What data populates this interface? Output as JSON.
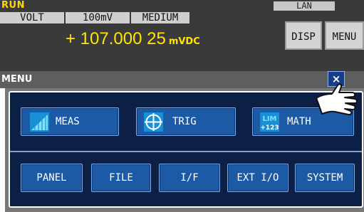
{
  "status": {
    "mode": "RUN",
    "interface": "LAN",
    "function": "VOLT",
    "range": "100mV",
    "speed": "MEDIUM",
    "reading": "+ 107.000 25",
    "unit": "mVDC"
  },
  "side_buttons": {
    "disp": "DISP",
    "menu": "MENU"
  },
  "menu": {
    "title": "MENU",
    "close": "×",
    "row1": [
      {
        "label": "MEAS",
        "icon": "bar-ramp-icon"
      },
      {
        "label": "TRIG",
        "icon": "crosshair-target-icon"
      },
      {
        "label": "MATH",
        "icon": "lim-math-icon",
        "icon_text_top": "LIM",
        "icon_text_bottom": "+123"
      }
    ],
    "row2": [
      {
        "label": "PANEL"
      },
      {
        "label": "FILE"
      },
      {
        "label": "I/F"
      },
      {
        "label": "EXT I/O"
      },
      {
        "label": "SYSTEM"
      }
    ]
  },
  "colors": {
    "status_bg": "#3a3a3a",
    "reading": "#ffe600",
    "run": "#ffd800",
    "button_blue": "#1c5aa6",
    "panel_bg": "#0c1f45",
    "close_bg": "#173e84"
  }
}
